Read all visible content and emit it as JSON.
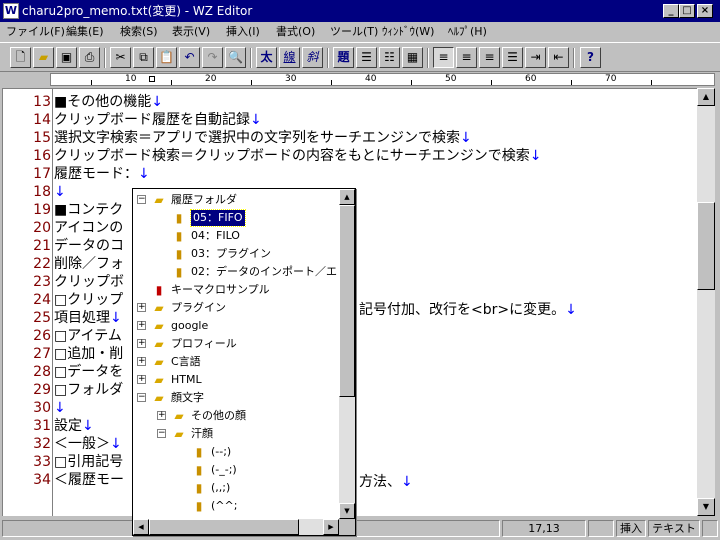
{
  "window": {
    "title": "charu2pro_memo.txt(変更) - WZ Editor",
    "icon": "W",
    "minimize": "_",
    "maximize": "□",
    "close": "×"
  },
  "menu": [
    "ファイル(F)",
    "編集(E)",
    "検索(S)",
    "表示(V)",
    "挿入(I)",
    "書式(O)",
    "ツール(T)",
    "ｳｨﾝﾄﾞｳ(W)",
    "ﾍﾙﾌﾟ(H)"
  ],
  "toolbar": {
    "bold": "太",
    "underline": "線",
    "italic": "斜",
    "heading": "題",
    "help": "?"
  },
  "ruler": {
    "labels": [
      "10",
      "20",
      "30",
      "40",
      "50",
      "60",
      "70"
    ]
  },
  "editor": {
    "newline_mark": "↓",
    "lines": [
      {
        "num": "13",
        "text": "■その他の機能",
        "nl": true
      },
      {
        "num": "14",
        "text": "クリップボード履歴を自動記録",
        "nl": true
      },
      {
        "num": "15",
        "text": "選択文字検索＝アプリで選択中の文字列をサーチエンジンで検索",
        "nl": true
      },
      {
        "num": "16",
        "text": "クリップボード検索＝クリップボードの内容をもとにサーチエンジンで検索",
        "nl": true
      },
      {
        "num": "17",
        "text": "履歴モード：",
        "nl": true
      },
      {
        "num": "18",
        "text": "",
        "nl": true
      },
      {
        "num": "19",
        "text": "■コンテク",
        "nl": false
      },
      {
        "num": "20",
        "text": "アイコンの",
        "nl": false
      },
      {
        "num": "21",
        "text": "データのコ",
        "nl": false
      },
      {
        "num": "22",
        "text": "削除／フォ",
        "nl": false
      },
      {
        "num": "23",
        "text": "クリップボ",
        "nl": false
      },
      {
        "num": "24",
        "text": "□クリップ",
        "nl": false
      },
      {
        "num": "25",
        "text": "項目処理",
        "nl": true
      },
      {
        "num": "26",
        "text": "□アイテム",
        "nl": false
      },
      {
        "num": "27",
        "text": "□追加・削",
        "nl": false
      },
      {
        "num": "28",
        "text": "□データを",
        "nl": false
      },
      {
        "num": "29",
        "text": "□フォルダ",
        "nl": false
      },
      {
        "num": "30",
        "text": "",
        "nl": true
      },
      {
        "num": "31",
        "text": "設定",
        "nl": true
      },
      {
        "num": "32",
        "text": "＜一般＞",
        "nl": true
      },
      {
        "num": "33",
        "text": "□引用記号",
        "nl": false
      },
      {
        "num": "34",
        "text": "＜履歴モー",
        "nl": false
      }
    ],
    "overflow_24": "記号付加、改行を<br>に変更。",
    "overflow_33": "方法、"
  },
  "popup": {
    "items": [
      {
        "label": "履歴フォルダ",
        "level": 0,
        "icon": "folder-open",
        "expander": "−"
      },
      {
        "label": "05：FIFO",
        "level": 1,
        "icon": "doc-edit",
        "selected": true
      },
      {
        "label": "04：FILO",
        "level": 1,
        "icon": "doc"
      },
      {
        "label": "03：プラグイン",
        "level": 1,
        "icon": "doc"
      },
      {
        "label": "02：データのインポート／エ",
        "level": 1,
        "icon": "doc"
      },
      {
        "label": "キーマクロサンプル",
        "level": 0,
        "icon": "macro"
      },
      {
        "label": "プラグイン",
        "level": 0,
        "icon": "folder",
        "expander": "+"
      },
      {
        "label": "google",
        "level": 0,
        "icon": "folder",
        "expander": "+"
      },
      {
        "label": "プロフィール",
        "level": 0,
        "icon": "folder",
        "expander": "+"
      },
      {
        "label": "C言語",
        "level": 0,
        "icon": "folder",
        "expander": "+"
      },
      {
        "label": "HTML",
        "level": 0,
        "icon": "folder",
        "expander": "+"
      },
      {
        "label": "顔文字",
        "level": 0,
        "icon": "folder",
        "expander": "−"
      },
      {
        "label": "その他の顔",
        "level": 1,
        "icon": "folder",
        "expander": "+"
      },
      {
        "label": "汗顔",
        "level": 1,
        "icon": "folder",
        "expander": "−"
      },
      {
        "label": "(--;)",
        "level": 2,
        "icon": "doc"
      },
      {
        "label": "(-_-;)",
        "level": 2,
        "icon": "doc"
      },
      {
        "label": "(,,;)",
        "level": 2,
        "icon": "doc"
      },
      {
        "label": "(^^;",
        "level": 2,
        "icon": "doc"
      }
    ]
  },
  "status": {
    "position": "17,13",
    "mode": "挿入",
    "type": "テキスト"
  }
}
